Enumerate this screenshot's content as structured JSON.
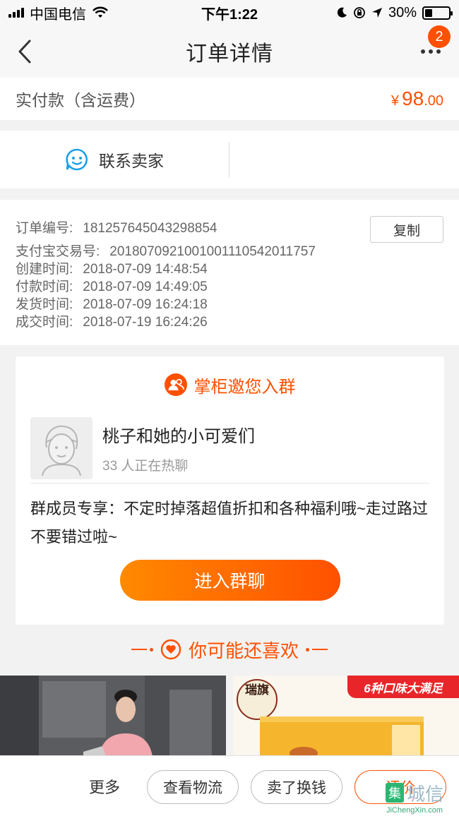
{
  "status_bar": {
    "carrier": "中国电信",
    "time": "下午1:22",
    "battery": "30%",
    "battery_level": 0.3
  },
  "nav": {
    "title": "订单详情",
    "badge": "2"
  },
  "payment": {
    "label": "实付款（含运费）",
    "currency": "¥",
    "amount_int": "98",
    "amount_dec": ".00"
  },
  "contact": {
    "label": "联系卖家"
  },
  "order_info": {
    "order_no_label": "订单编号:",
    "order_no": "181257645043298854",
    "copy_label": "复制",
    "alipay_label": "支付宝交易号:",
    "alipay_no": "2018070921001001110542011757",
    "created_label": "创建时间:",
    "created": "2018-07-09 14:48:54",
    "paid_label": "付款时间:",
    "paid": "2018-07-09 14:49:05",
    "shipped_label": "发货时间:",
    "shipped": "2018-07-09 16:24:18",
    "done_label": "成交时间:",
    "done": "2018-07-19 16:24:26"
  },
  "group_invite": {
    "title": "掌柜邀您入群",
    "group_name": "桃子和她的小可爱们",
    "member_count": "33 人正在热聊",
    "description": "群成员专享：不定时掉落超值折扣和各种福利哦~走过路过不要错过啦~",
    "join_label": "进入群聊"
  },
  "recommend": {
    "title": "你可能还喜欢",
    "promo_badge": "6种口味大满足",
    "brand_text": "瑞旗"
  },
  "bottom_bar": {
    "more": "更多",
    "logistics": "查看物流",
    "resell": "卖了换钱",
    "review": "评价"
  },
  "watermark": {
    "main": "城信",
    "box": "集",
    "sub": "JiChengXin.com"
  },
  "colors": {
    "accent": "#ff5000",
    "background": "#f2f2f2"
  }
}
